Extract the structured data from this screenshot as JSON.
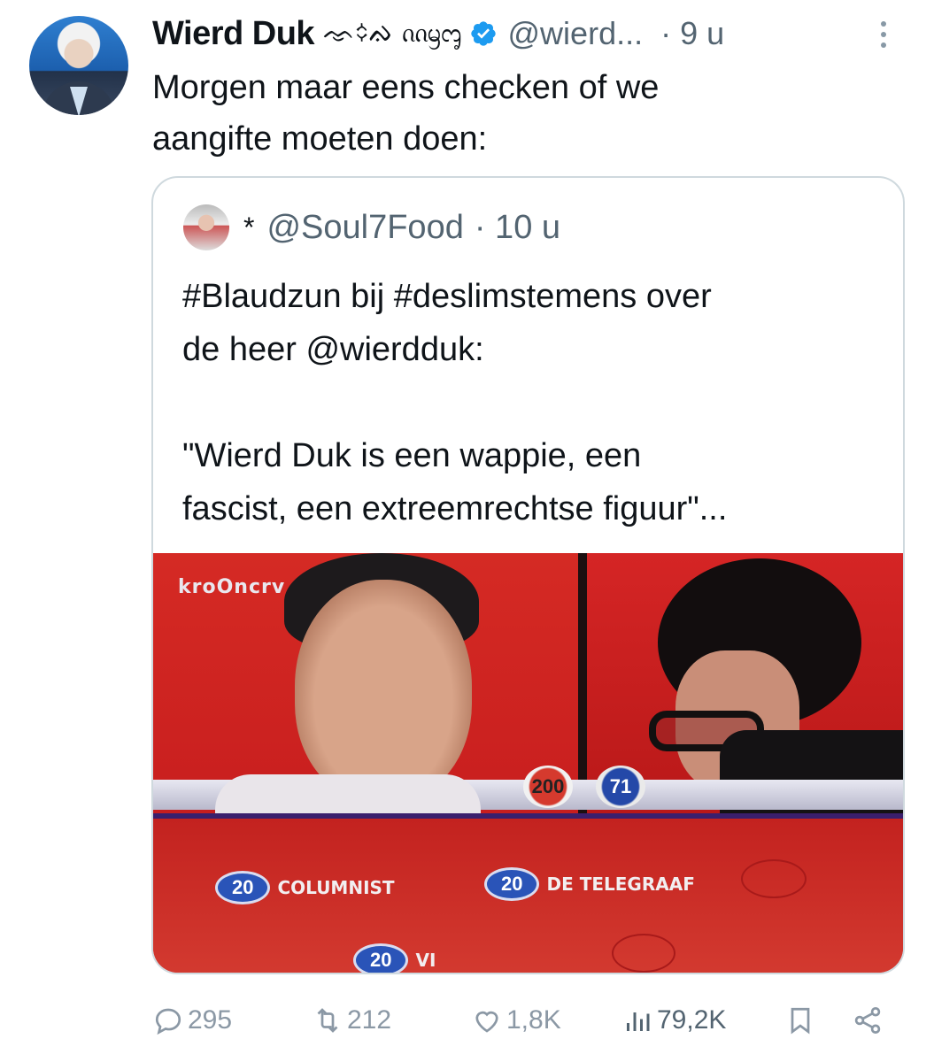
{
  "tweet": {
    "author_name": "Wierd Duk",
    "author_name_deco": "ᨎ᨟ᨁ ᦶᦙᧅ",
    "handle": "@wierd...",
    "time": "· 9 u",
    "text": "Morgen maar eens checken of we\naangifte moeten doen:"
  },
  "quote": {
    "name": "*",
    "handle": "@Soul7Food",
    "time": "· 10 u",
    "text": "#Blaudzun bij #deslimstemens over\nde heer @wierdduk:\n\n\"Wierd Duk is een wappie, een\nfascist, een extreemrechtse figuur\"..."
  },
  "media": {
    "logo": "kroOncrv",
    "score_left": "200",
    "score_right": "71",
    "answers": [
      {
        "points": "20",
        "label": "COLUMNIST"
      },
      {
        "points": "20",
        "label": "DE TELEGRAAF"
      },
      {
        "points": "20",
        "label": "VI"
      }
    ]
  },
  "actions": {
    "replies": "295",
    "reposts": "212",
    "likes": "1,8K",
    "views": "79,2K"
  },
  "colors": {
    "verified": "#1d9bf0",
    "muted": "#536471",
    "action_gray": "#8b98a5",
    "border": "#cfd9de"
  },
  "icons": [
    "verified-icon",
    "more-icon",
    "reply-icon",
    "repost-icon",
    "like-icon",
    "views-icon",
    "bookmark-icon",
    "share-icon"
  ]
}
